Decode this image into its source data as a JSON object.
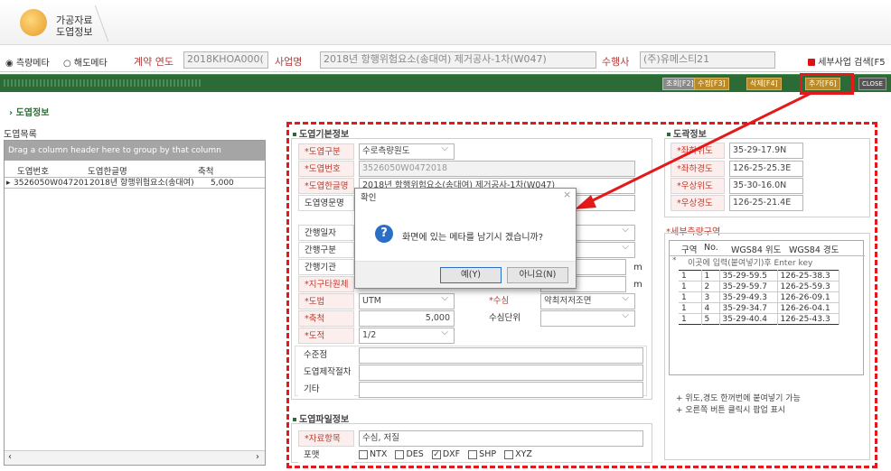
{
  "header": {
    "app_title_line1": "가공자료",
    "app_title_line2": "도엽정보"
  },
  "search": {
    "radio_survey": "측량메타",
    "radio_chart": "해도메타",
    "contract_year_label": "계약 연도",
    "contract_year_value": "2018KHOA000(",
    "project_label": "사업명",
    "project_value": "2018년 항행위험요소(송대여) 제거공사-1차(W047)",
    "contractor_label": "수행사",
    "contractor_value": "(주)유메스티21",
    "detail_search_btn": "세부사업 검색[F5"
  },
  "toolbar": {
    "btn_search": "조회[F2]",
    "btn_edit": "수정[F3]",
    "btn_delete": "삭제[F4]",
    "btn_add": "추가[F6]",
    "btn_close": "CLOSE"
  },
  "breadcrumb": "도엽정보",
  "left_panel": {
    "title": "도엽목록",
    "group_hint": "Drag a column header here to group by that column",
    "columns": [
      "도엽번호",
      "도엽한글명",
      "축척"
    ],
    "rows": [
      {
        "no": "3526050W047201",
        "name": "2018년 항행위험요소(송대여)",
        "scale": "5,000"
      }
    ]
  },
  "basic": {
    "title": "도엽기본정보",
    "type_label": "*도엽구분",
    "type_value": "수로측량원도",
    "number_label": "*도엽번호",
    "number_value": "3526050W0472018",
    "kname_label": "*도엽한글명",
    "kname_value": "2018년 항행위험요소(송대여) 제거공사-1차(W047)",
    "ename_label": "도엽영문명",
    "pubdate_label": "간행일자",
    "pubtype_label": "간행구분",
    "agency_label": "간행기관",
    "earth_label": "*지구타원체",
    "proj_label": "*도법",
    "proj_value": "UTM",
    "depth_label": "*수심",
    "depth_value": "약최저저조면",
    "hdatum_value": "조면",
    "scale_label": "*축척",
    "scale_value": "5,000",
    "unit_label": "수심단위",
    "sheet_label": "*도적",
    "sheet_value": "1/2",
    "m1": "m",
    "m2": "m",
    "level_label": "수준점",
    "proc_label": "도엽제작절차",
    "etc_label": "기타"
  },
  "coords": {
    "title": "도곽정보",
    "s_lat_label": "*좌하위도",
    "s_lat_value": "35-29-17.9N",
    "s_lon_label": "*좌하경도",
    "s_lon_value": "126-25-25.3E",
    "n_lat_label": "*우상위도",
    "n_lat_value": "35-30-16.0N",
    "n_lon_label": "*우상경도",
    "n_lon_value": "126-25-21.4E"
  },
  "survey_area": {
    "title": "*세부측량구역",
    "columns": [
      "구역",
      "No.",
      "WGS84 위도",
      "WGS84 경도"
    ],
    "input_hint": "이곳에 입력(붙여넣기)후 Enter key",
    "rows": [
      {
        "area": "1",
        "no": "1",
        "lat": "35-29-59.5",
        "lon": "126-25-38.3"
      },
      {
        "area": "1",
        "no": "2",
        "lat": "35-29-59.7",
        "lon": "126-25-59.3"
      },
      {
        "area": "1",
        "no": "3",
        "lat": "35-29-49.3",
        "lon": "126-26-09.1"
      },
      {
        "area": "1",
        "no": "4",
        "lat": "35-29-34.7",
        "lon": "126-26-04.1"
      },
      {
        "area": "1",
        "no": "5",
        "lat": "35-29-40.4",
        "lon": "126-25-43.3"
      }
    ],
    "note1": "+ 위도,경도 한꺼번에 붙여넣기 가능",
    "note2": "+ 오른쪽 버튼 클릭시 팝업 표시"
  },
  "file_info": {
    "title": "도엽파일정보",
    "items_label": "*자료항목",
    "items_value": "수심, 저질",
    "format_label": "포맷",
    "formats": [
      {
        "name": "NTX",
        "checked": "false"
      },
      {
        "name": "DES",
        "checked": "false"
      },
      {
        "name": "DXF",
        "checked": "true"
      },
      {
        "name": "SHP",
        "checked": "false"
      },
      {
        "name": "XYZ",
        "checked": "false"
      }
    ]
  },
  "dialog": {
    "title": "확인",
    "message": "화면에 있는 메타를 남기시 겠습니까?",
    "yes": "예(Y)",
    "no": "아니요(N)"
  },
  "colors": {
    "toolbar_green": "#2d6b36",
    "highlight_red": "#e3191b",
    "required_red": "#c0392b"
  }
}
